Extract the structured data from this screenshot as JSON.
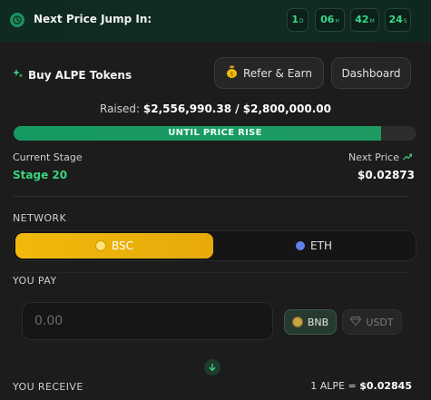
{
  "topbar": {
    "title": "Next Price Jump In:",
    "countdown": [
      {
        "value": "1",
        "unit": "D"
      },
      {
        "value": "06",
        "unit": "H"
      },
      {
        "value": "42",
        "unit": "M"
      },
      {
        "value": "24",
        "unit": "S"
      }
    ]
  },
  "header": {
    "buy_title": "Buy ALPE Tokens",
    "refer_label": "Refer & Earn",
    "dashboard_label": "Dashboard"
  },
  "raise": {
    "prefix": "Raised:",
    "amount": "$2,556,990.38 / $2,800,000.00",
    "progress_fraction": 0.913,
    "progress_label": "UNTIL PRICE RISE"
  },
  "stage": {
    "current_label": "Current Stage",
    "current_value": "Stage 20",
    "next_label": "Next Price",
    "next_value": "$0.02873"
  },
  "network": {
    "label": "NETWORK",
    "options": [
      "BSC",
      "ETH"
    ],
    "selected": "BSC"
  },
  "pay": {
    "label": "YOU PAY",
    "placeholder": "0.00",
    "value": "",
    "tokens": [
      "BNB",
      "USDT"
    ],
    "selected_token": "BNB"
  },
  "receive": {
    "label": "YOU RECEIVE",
    "rate_prefix": "1 ALPE =",
    "rate_value": "$0.02845"
  },
  "colors": {
    "accent_green": "#3ad47f",
    "bsc_yellow": "#f0b90b",
    "eth_blue": "#627eea"
  }
}
